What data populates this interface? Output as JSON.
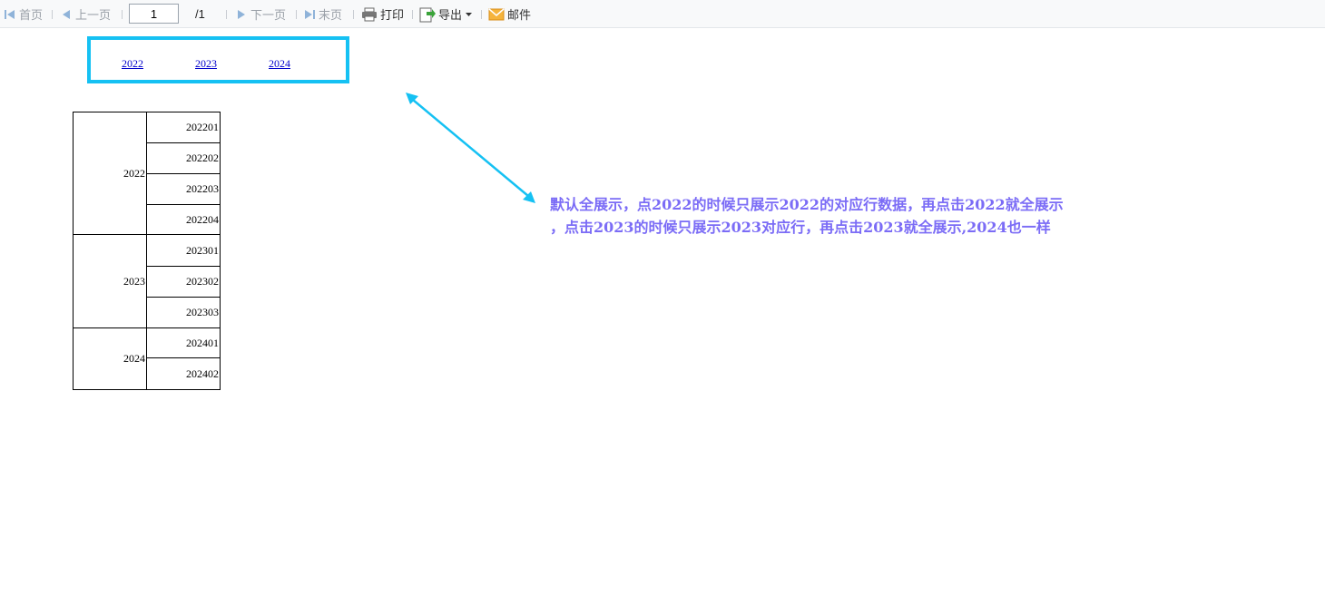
{
  "toolbar": {
    "first_label": "首页",
    "prev_label": "上一页",
    "page_value": "1",
    "page_total": "/1",
    "next_label": "下一页",
    "last_label": "末页",
    "print_label": "打印",
    "export_label": "导出",
    "mail_label": "邮件"
  },
  "year_links": [
    "2022",
    "2023",
    "2024"
  ],
  "table": {
    "groups": [
      {
        "year": "2022",
        "months": [
          "202201",
          "202202",
          "202203",
          "202204"
        ]
      },
      {
        "year": "2023",
        "months": [
          "202301",
          "202302",
          "202303"
        ]
      },
      {
        "year": "2024",
        "months": [
          "202401",
          "202402"
        ]
      }
    ]
  },
  "annotation": {
    "line1": "默认全展示，点2022的时候只展示2022的对应行数据，再点击2022就全展示",
    "line2": "，点击2023的时候只展示2023对应行，再点击2023就全展示,2024也一样"
  },
  "colors": {
    "highlight_box": "#15c1f3",
    "arrow": "#15c1f3",
    "annotation_text": "#7b6cf6",
    "link": "#0000cc"
  }
}
